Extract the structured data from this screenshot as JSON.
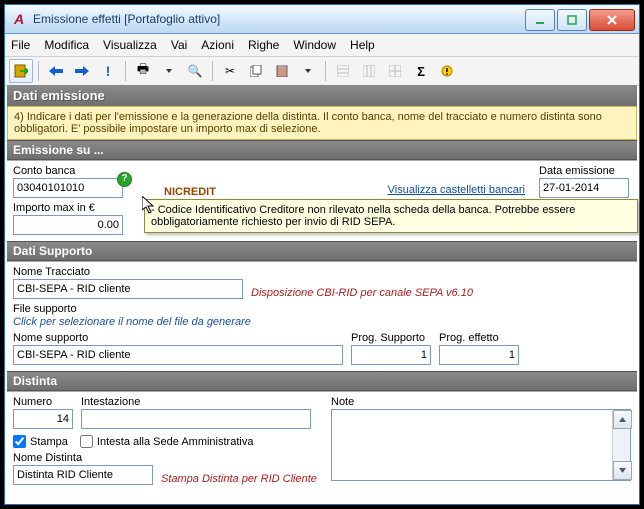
{
  "window": {
    "title": "Emissione effetti [Portafoglio attivo]"
  },
  "menu": [
    "File",
    "Modifica",
    "Visualizza",
    "Vai",
    "Azioni",
    "Righe",
    "Window",
    "Help"
  ],
  "panel_title": "Dati emissione",
  "help_text": "4) Indicare i dati per l'emissione e la generazione della distinta. Il conto banca, nome del tracciato e numero distinta sono obbligatori. E' possibile impostare un importo max di selezione.",
  "emissione": {
    "header": "Emissione su ...",
    "conto_label": "Conto banca",
    "conto_value": "03040101010",
    "bank_name": "NICREDIT",
    "link": "Visualizza castelletti bancari",
    "data_label": "Data emissione",
    "data_value": "27-01-2014",
    "importo_label": "Importo max in €",
    "importo_value": "0.00"
  },
  "tooltip": "- Codice Identificativo Creditore non rilevato nella scheda della banca. Potrebbe essere obbligatoriamente richiesto per invio di RID SEPA.",
  "supporto": {
    "header": "Dati Supporto",
    "nome_tracciato_label": "Nome Tracciato",
    "nome_tracciato_value": "CBI-SEPA - RID cliente",
    "nome_tracciato_desc": "Disposizione CBI-RID per canale SEPA v6.10",
    "file_label": "File supporto",
    "file_hint": "Click per selezionare il nome del file da generare",
    "nome_supporto_label": "Nome supporto",
    "nome_supporto_value": "CBI-SEPA - RID cliente",
    "prog_supporto_label": "Prog. Supporto",
    "prog_supporto_value": "1",
    "prog_effetto_label": "Prog. effetto",
    "prog_effetto_value": "1"
  },
  "distinta": {
    "header": "Distinta",
    "numero_label": "Numero",
    "numero_value": "14",
    "intestazione_label": "Intestazione",
    "intestazione_value": "",
    "note_label": "Note",
    "stampa_label": "Stampa",
    "intesta_label": "Intesta alla Sede Amministrativa",
    "nome_label": "Nome Distinta",
    "nome_value": "Distinta RID Cliente",
    "nome_desc": "Stampa Distinta per RID Cliente"
  }
}
